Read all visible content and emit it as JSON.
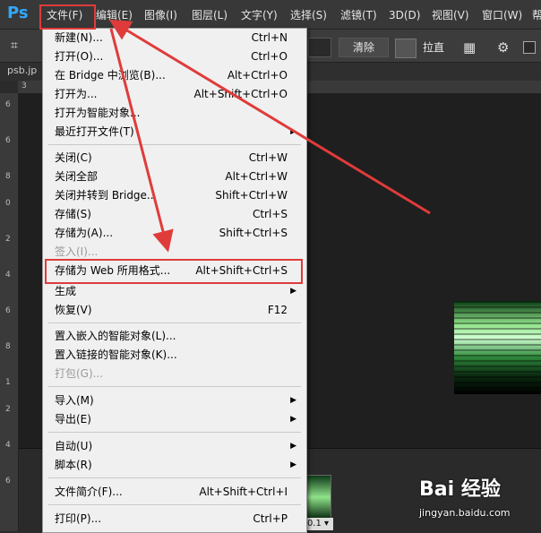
{
  "app": {
    "logo": "Ps"
  },
  "menubar": {
    "items": [
      {
        "label": "文件(F)"
      },
      {
        "label": "编辑(E)"
      },
      {
        "label": "图像(I)"
      },
      {
        "label": "图层(L)"
      },
      {
        "label": "文字(Y)"
      },
      {
        "label": "选择(S)"
      },
      {
        "label": "滤镜(T)"
      },
      {
        "label": "3D(D)"
      },
      {
        "label": "视图(V)"
      },
      {
        "label": "窗口(W)"
      },
      {
        "label": "帮"
      }
    ]
  },
  "options": {
    "clear_label": "清除",
    "straighten_label": "拉直"
  },
  "tab": {
    "doc_name": "psb.jp"
  },
  "rulers": {
    "top": [
      "3"
    ],
    "left": [
      "6",
      "6",
      "8",
      "0",
      "2",
      "4",
      "6",
      "8",
      "1",
      "2",
      "4",
      "6"
    ]
  },
  "file_menu": {
    "items": [
      {
        "label": "新建(N)...",
        "shortcut": "Ctrl+N"
      },
      {
        "label": "打开(O)...",
        "shortcut": "Ctrl+O"
      },
      {
        "label": "在 Bridge 中浏览(B)...",
        "shortcut": "Alt+Ctrl+O"
      },
      {
        "label": "打开为...",
        "shortcut": "Alt+Shift+Ctrl+O"
      },
      {
        "label": "打开为智能对象...",
        "shortcut": ""
      },
      {
        "label": "最近打开文件(T)",
        "shortcut": "",
        "submenu": "▶"
      },
      {
        "label": "关闭(C)",
        "shortcut": "Ctrl+W"
      },
      {
        "label": "关闭全部",
        "shortcut": "Alt+Ctrl+W"
      },
      {
        "label": "关闭并转到 Bridge...",
        "shortcut": "Shift+Ctrl+W"
      },
      {
        "label": "存储(S)",
        "shortcut": "Ctrl+S"
      },
      {
        "label": "存储为(A)...",
        "shortcut": "Shift+Ctrl+S"
      },
      {
        "label": "签入(I)...",
        "shortcut": "",
        "disabled": true
      },
      {
        "label": "存储为 Web 所用格式...",
        "shortcut": "Alt+Shift+Ctrl+S"
      },
      {
        "label": "生成",
        "shortcut": "",
        "submenu": "▶"
      },
      {
        "label": "恢复(V)",
        "shortcut": "F12"
      },
      {
        "label": "置入嵌入的智能对象(L)...",
        "shortcut": ""
      },
      {
        "label": "置入链接的智能对象(K)...",
        "shortcut": ""
      },
      {
        "label": "打包(G)...",
        "shortcut": "",
        "disabled": true
      },
      {
        "label": "导入(M)",
        "shortcut": "",
        "submenu": "▶"
      },
      {
        "label": "导出(E)",
        "shortcut": "",
        "submenu": "▶"
      },
      {
        "label": "自动(U)",
        "shortcut": "",
        "submenu": "▶"
      },
      {
        "label": "脚本(R)",
        "shortcut": "",
        "submenu": "▶"
      },
      {
        "label": "文件简介(F)...",
        "shortcut": "Alt+Shift+Ctrl+I"
      },
      {
        "label": "打印(P)...",
        "shortcut": "Ctrl+P"
      }
    ]
  },
  "filmstrip": {
    "zoom_label": "0.1"
  },
  "watermark": {
    "brand": "Bai 经验",
    "site": "jingyan.baidu.com"
  },
  "colors": {
    "highlight": "#e03b3b",
    "menu_bg": "#f0f0f0",
    "app_bg": "#2b2b2b",
    "ps_blue": "#31a8ff"
  }
}
